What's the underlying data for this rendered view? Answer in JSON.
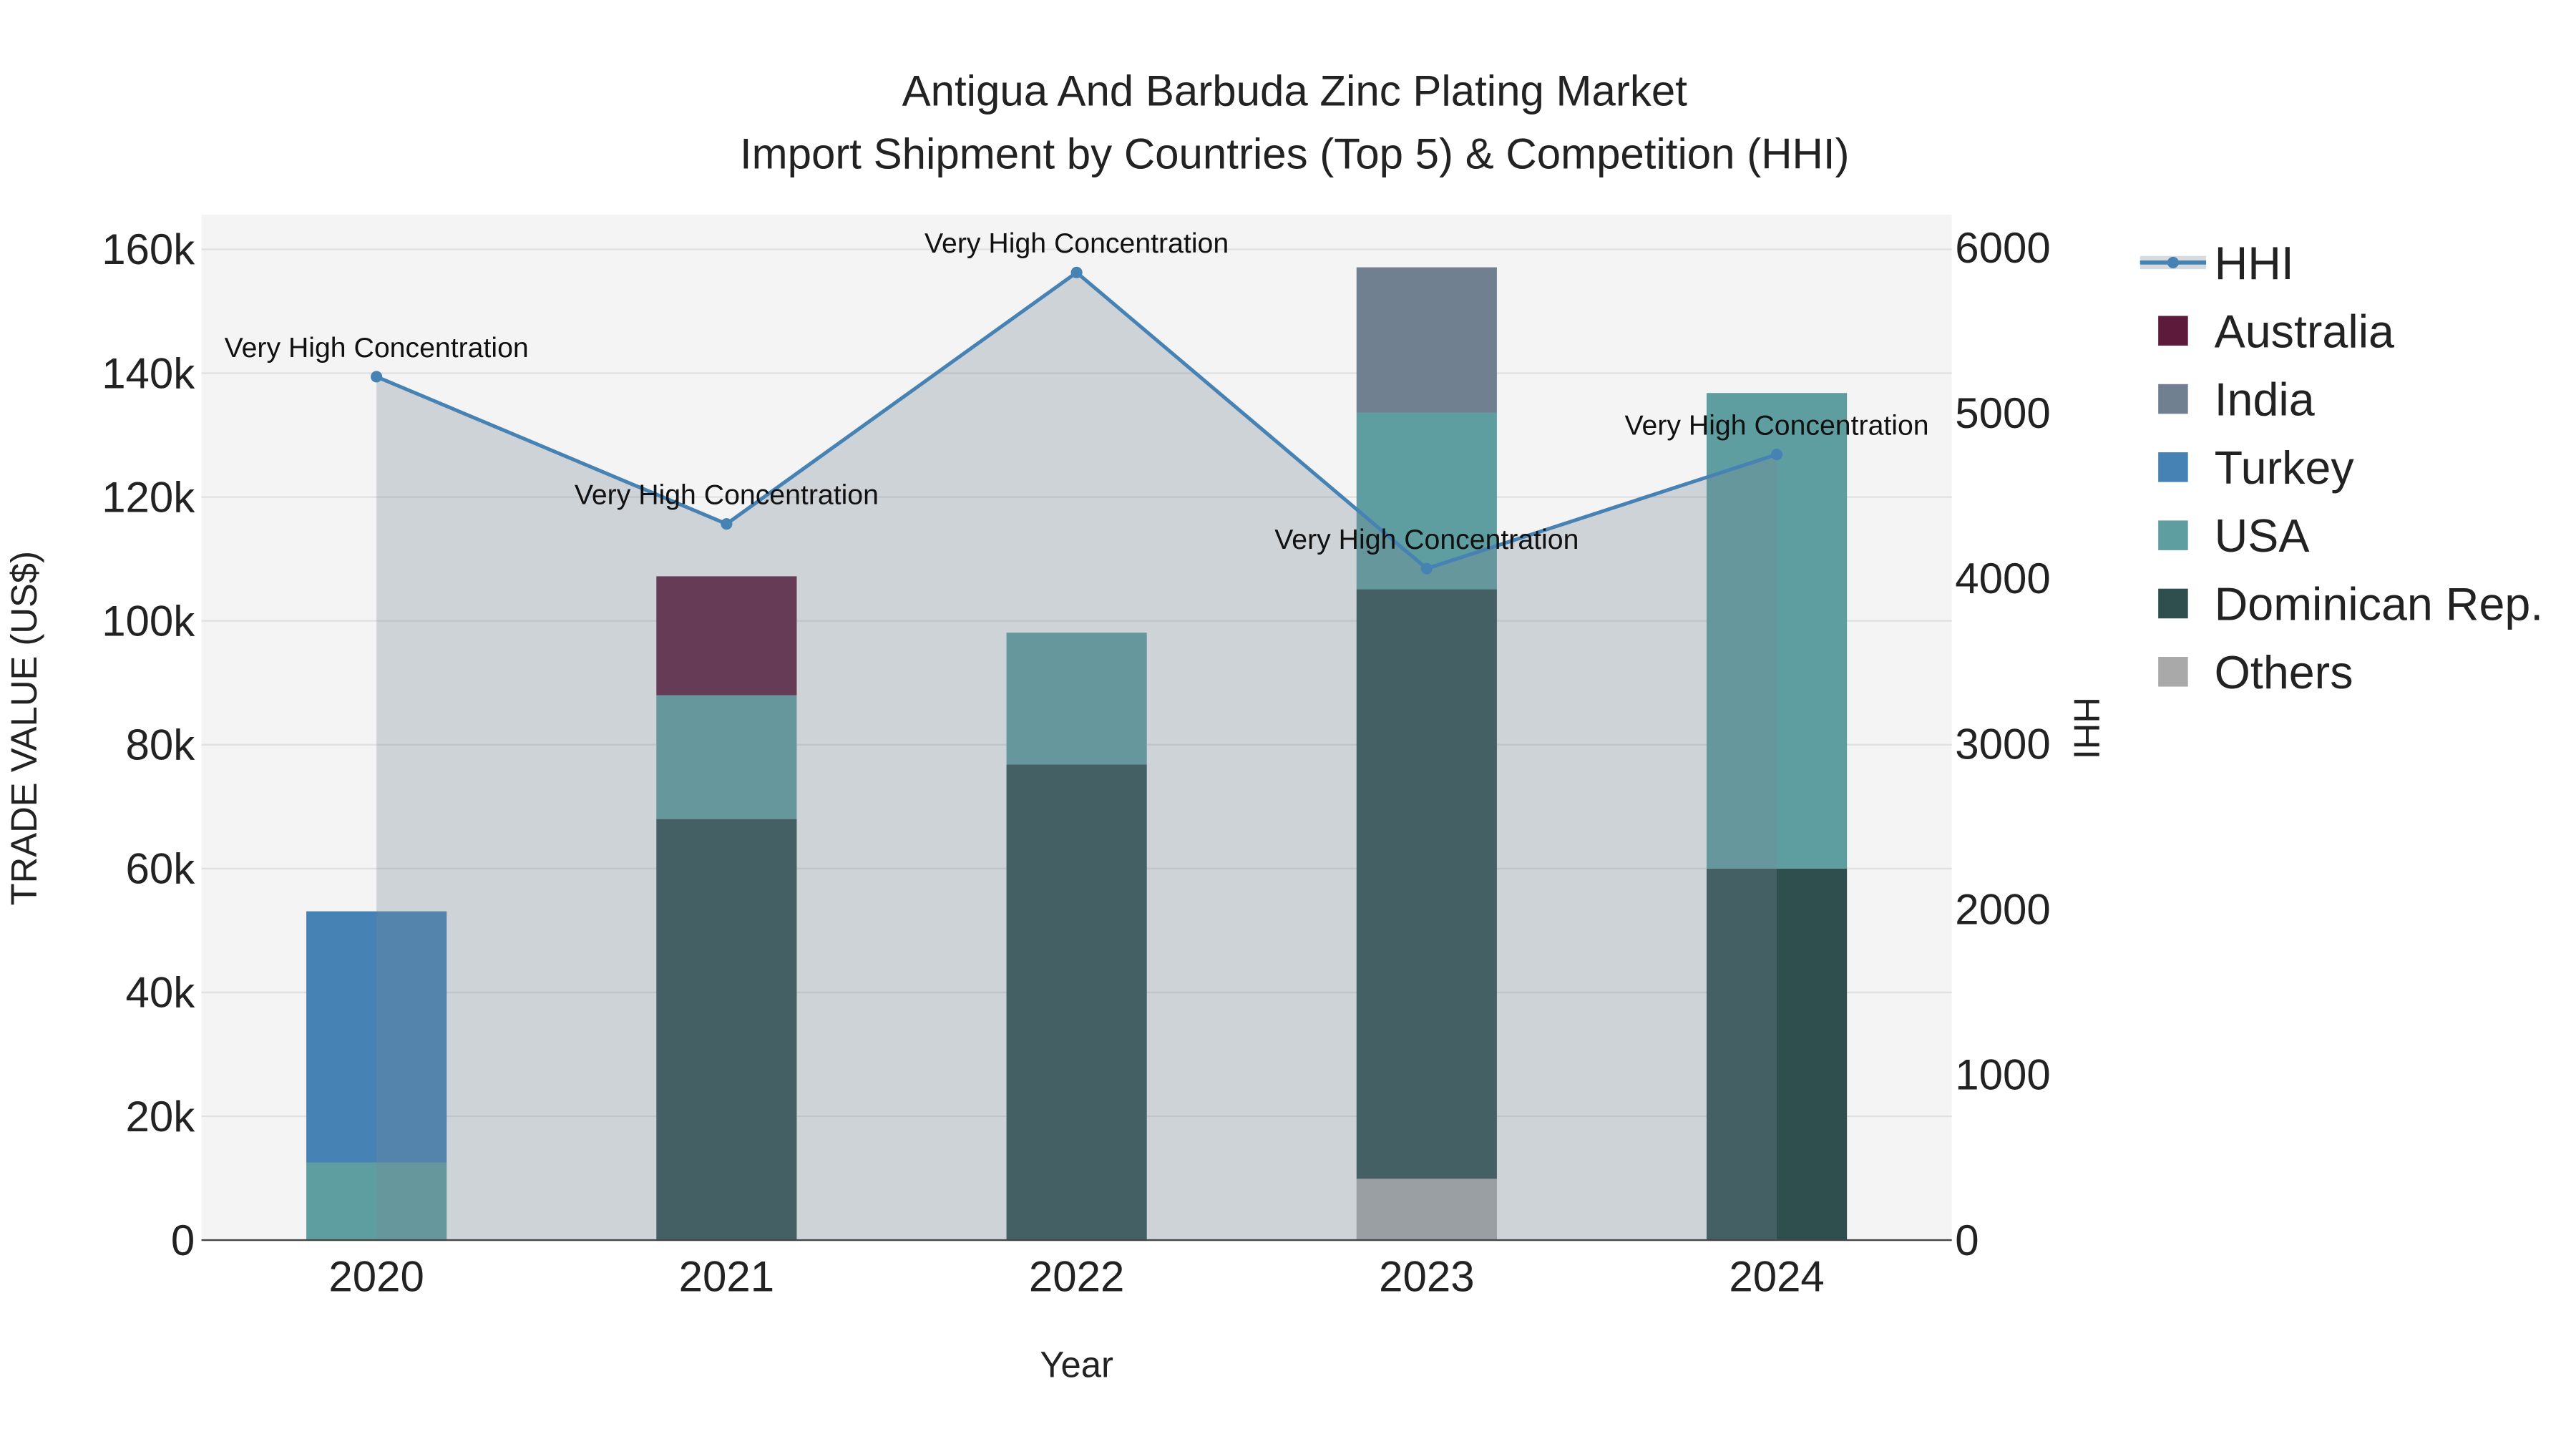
{
  "chart_data": {
    "type": "bar",
    "title": "Antigua And Barbuda Zinc Plating Market",
    "subtitle": "Import Shipment by Countries (Top 5) & Competition (HHI)",
    "xlabel": "Year",
    "ylabel": "TRADE VALUE (US$)",
    "y2label": "HHI",
    "categories": [
      "2020",
      "2021",
      "2022",
      "2023",
      "2024"
    ],
    "ylim": [
      0,
      165000
    ],
    "y2lim": [
      0,
      6187.5
    ],
    "yticks": [
      0,
      20000,
      40000,
      60000,
      80000,
      100000,
      120000,
      140000,
      160000
    ],
    "ytick_labels": [
      "0",
      "20k",
      "40k",
      "60k",
      "80k",
      "100k",
      "120k",
      "140k",
      "160k"
    ],
    "y2ticks": [
      0,
      1000,
      2000,
      3000,
      4000,
      5000,
      6000
    ],
    "y2tick_labels": [
      "0",
      "1000",
      "2000",
      "3000",
      "4000",
      "5000",
      "6000"
    ],
    "series": [
      {
        "name": "Others",
        "color": "#a9a9a9",
        "values": [
          0,
          0,
          0,
          9900,
          0
        ]
      },
      {
        "name": "Dominican Rep.",
        "color": "#2f4f4f",
        "values": [
          0,
          68000,
          76800,
          95200,
          60000
        ]
      },
      {
        "name": "USA",
        "color": "#5f9ea0",
        "values": [
          12500,
          20000,
          21300,
          28500,
          76800
        ]
      },
      {
        "name": "Turkey",
        "color": "#4682b4",
        "values": [
          40600,
          0,
          0,
          0,
          0
        ]
      },
      {
        "name": "India",
        "color": "#708090",
        "values": [
          0,
          0,
          0,
          23500,
          0
        ]
      },
      {
        "name": "Australia",
        "color": "#5e1a3a",
        "values": [
          0,
          19200,
          0,
          0,
          0
        ]
      }
    ],
    "hhi": {
      "name": "HHI",
      "color": "#4682b4",
      "values": [
        5220,
        4330,
        5850,
        4060,
        4750
      ],
      "labels": [
        "Very High Concentration",
        "Very High Concentration",
        "Very High Concentration",
        "Very High Concentration",
        "Very High Concentration"
      ]
    },
    "legend": [
      "HHI",
      "Australia",
      "India",
      "Turkey",
      "USA",
      "Dominican Rep.",
      "Others"
    ],
    "legend_position": "right",
    "grid": true
  }
}
